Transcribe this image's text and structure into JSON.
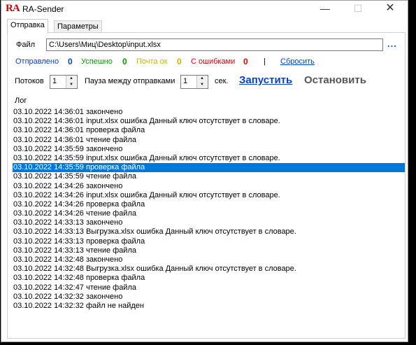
{
  "window": {
    "app_icon": "RA",
    "title": "RA-Sender",
    "minimize": "—",
    "maximize": "☐",
    "close": "✕"
  },
  "tabs": [
    {
      "label": "Отправка"
    },
    {
      "label": "Параметры"
    }
  ],
  "file": {
    "label": "Файл",
    "value": "C:\\Users\\Миц\\Desktop\\input.xlsx",
    "browse": "..."
  },
  "stats": {
    "sent_label": "Отправлено",
    "sent_value": "0",
    "success_label": "Успешно",
    "success_value": "0",
    "mail_ok_label": "Почта ок",
    "mail_ok_value": "0",
    "errors_label": "С ошибками",
    "errors_value": "0",
    "separator": "|",
    "reset_label": "Сбросить",
    "colors": {
      "sent": "#0044cc",
      "success": "#00a000",
      "mail_ok": "#c8b400",
      "errors": "#e00000"
    }
  },
  "controls": {
    "threads_label": "Потоков",
    "threads_value": "1",
    "pause_label": "Пауза между отправками",
    "pause_value": "1",
    "pause_unit": "сек.",
    "start_label": "Запустить",
    "stop_label": "Остановить"
  },
  "log": {
    "label": "Лог",
    "selected_index": 6,
    "entries": [
      "03.10.2022 14:36:01 закончено",
      "03.10.2022 14:36:01 input.xlsx ошибка Данный ключ отсутствует в словаре.",
      "03.10.2022 14:36:01 проверка файла",
      "03.10.2022 14:36:01 чтение файла",
      "03.10.2022 14:35:59 закончено",
      "03.10.2022 14:35:59 input.xlsx ошибка Данный ключ отсутствует в словаре.",
      "03.10.2022 14:35:59 проверка файла",
      "03.10.2022 14:35:59 чтение файла",
      "03.10.2022 14:34:26 закончено",
      "03.10.2022 14:34:26 input.xlsx ошибка Данный ключ отсутствует в словаре.",
      "03.10.2022 14:34:26 проверка файла",
      "03.10.2022 14:34:26 чтение файла",
      "03.10.2022 14:33:13 закончено",
      "03.10.2022 14:33:13 Выгрузка.xlsx ошибка Данный ключ отсутствует в словаре.",
      "03.10.2022 14:33:13 проверка файла",
      "03.10.2022 14:33:13 чтение файла",
      "03.10.2022 14:32:48 закончено",
      "03.10.2022 14:32:48 Выгрузка.xlsx ошибка Данный ключ отсутствует в словаре.",
      "03.10.2022 14:32:48 проверка файла",
      "03.10.2022 14:32:47 чтение файла",
      "03.10.2022 14:32:32 закончено",
      "03.10.2022 14:32:32 файл не найден"
    ]
  }
}
